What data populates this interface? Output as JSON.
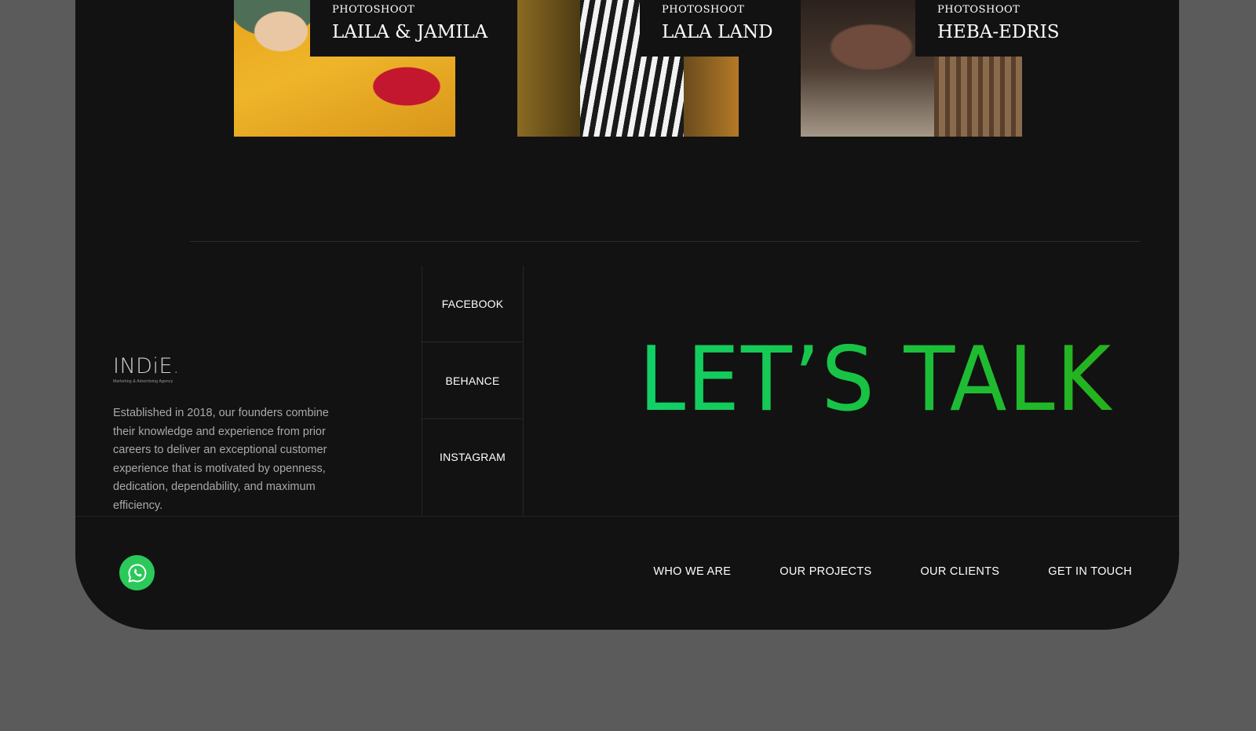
{
  "projects": [
    {
      "kicker": "PHOTOSHOOT",
      "title": "LAILA & JAMILA"
    },
    {
      "kicker": "PHOTOSHOOT",
      "title": "LALA LAND"
    },
    {
      "kicker": "PHOTOSHOOT",
      "title": "HEBA-EDRIS"
    }
  ],
  "brand": {
    "logo_text": "INDiE",
    "logo_dot": ".",
    "tagline": "Marketing & Advertising Agency",
    "description": "Established in 2018, our founders combine their knowledge and experience from prior careers to deliver an exceptional customer experience that is motivated by openness, dedication, dependability, and maximum efficiency."
  },
  "social": [
    "FACEBOOK",
    "BEHANCE",
    "INSTAGRAM"
  ],
  "cta": {
    "text": "LET’S TALK"
  },
  "nav": [
    "WHO WE ARE",
    "OUR PROJECTS",
    "OUR CLIENTS",
    "GET IN TOUCH"
  ],
  "icons": {
    "chat": "whatsapp-icon"
  },
  "colors": {
    "background": "#121212",
    "outer": "#5b5b5b",
    "accent_start": "#11d16a",
    "accent_end": "#26b21c",
    "whatsapp": "#2bc85a"
  }
}
